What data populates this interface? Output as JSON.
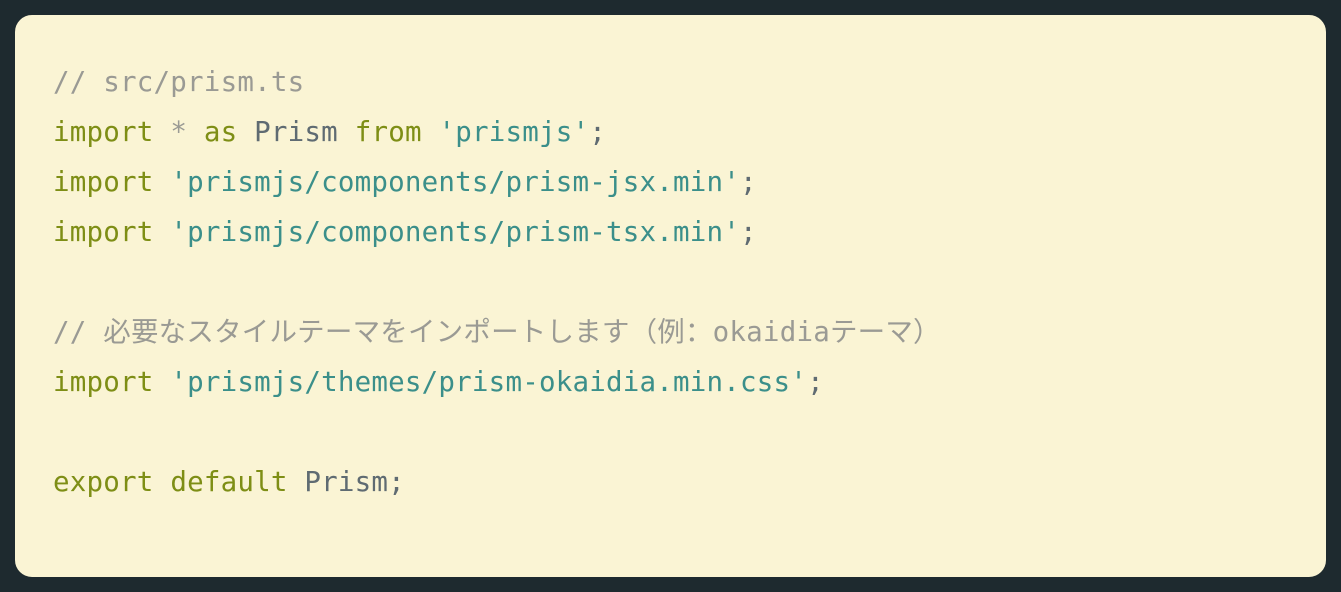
{
  "code": {
    "line1": {
      "comment": "// src/prism.ts"
    },
    "line2": {
      "kw_import": "import",
      "star": "*",
      "kw_as": "as",
      "ident": "Prism",
      "kw_from": "from",
      "str": "'prismjs'",
      "semi": ";"
    },
    "line3": {
      "kw_import": "import",
      "str": "'prismjs/components/prism-jsx.min'",
      "semi": ";"
    },
    "line4": {
      "kw_import": "import",
      "str": "'prismjs/components/prism-tsx.min'",
      "semi": ";"
    },
    "line5": {
      "blank": ""
    },
    "line6": {
      "comment": "// 必要なスタイルテーマをインポートします（例：okaidiaテーマ）"
    },
    "line7": {
      "kw_import": "import",
      "str": "'prismjs/themes/prism-okaidia.min.css'",
      "semi": ";"
    },
    "line8": {
      "blank": ""
    },
    "line9": {
      "kw_export": "export",
      "kw_default": "default",
      "ident": "Prism",
      "semi": ";"
    }
  },
  "colors": {
    "background_outer": "#1e2a2f",
    "background_inner": "#faf4d4",
    "comment": "#9a9a94",
    "keyword": "#7e8e15",
    "identifier": "#5f6b72",
    "string": "#3b8f8a"
  }
}
